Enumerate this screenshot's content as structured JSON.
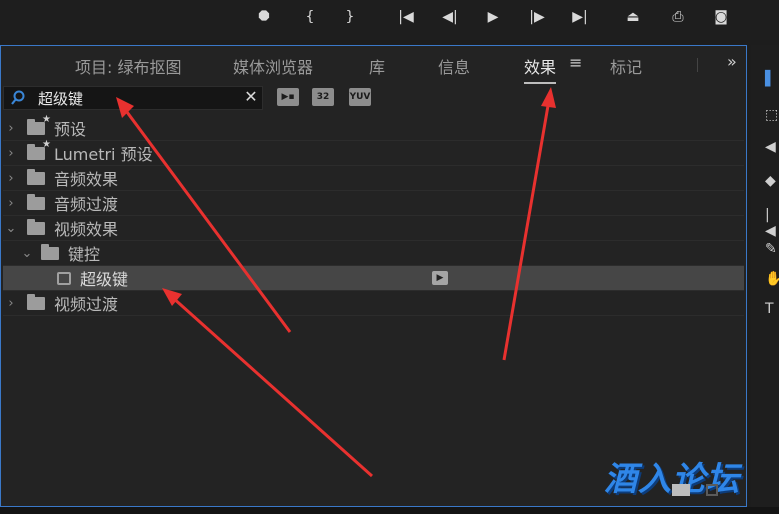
{
  "transport": {
    "buttons": [
      "marker-icon",
      "mark-in-icon",
      "mark-out-icon",
      "go-to-in-icon",
      "step-back-icon",
      "play-icon",
      "step-forward-icon",
      "go-to-out-icon",
      "lift-icon",
      "extract-icon",
      "export-frame-icon"
    ]
  },
  "tabs": [
    {
      "label": "项目: 绿布抠图",
      "active": false
    },
    {
      "label": "媒体浏览器",
      "active": false
    },
    {
      "label": "库",
      "active": false
    },
    {
      "label": "信息",
      "active": false
    },
    {
      "label": "效果",
      "active": true
    },
    {
      "label": "标记",
      "active": false
    }
  ],
  "tab_menu": "≡",
  "tab_overflow": "»",
  "search": {
    "value": "超级键",
    "clear": "✕"
  },
  "filter_buttons": [
    "accelerated-effects-icon",
    "32",
    "YUV"
  ],
  "tree": [
    {
      "label": "预设",
      "indent": 0,
      "expanded": false,
      "type": "preset-folder"
    },
    {
      "label": "Lumetri 预设",
      "indent": 0,
      "expanded": false,
      "type": "preset-folder"
    },
    {
      "label": "音频效果",
      "indent": 0,
      "expanded": false,
      "type": "folder"
    },
    {
      "label": "音频过渡",
      "indent": 0,
      "expanded": false,
      "type": "folder"
    },
    {
      "label": "视频效果",
      "indent": 0,
      "expanded": true,
      "type": "folder"
    },
    {
      "label": "键控",
      "indent": 1,
      "expanded": true,
      "type": "folder"
    },
    {
      "label": "超级键",
      "indent": 2,
      "type": "effect",
      "selected": true
    },
    {
      "label": "视频过渡",
      "indent": 0,
      "expanded": false,
      "type": "folder"
    }
  ],
  "watermark": "酒入论坛",
  "colors": {
    "accent": "#3a78c8",
    "annotation_arrow": "#e8312f",
    "watermark": "#2f86e8"
  }
}
